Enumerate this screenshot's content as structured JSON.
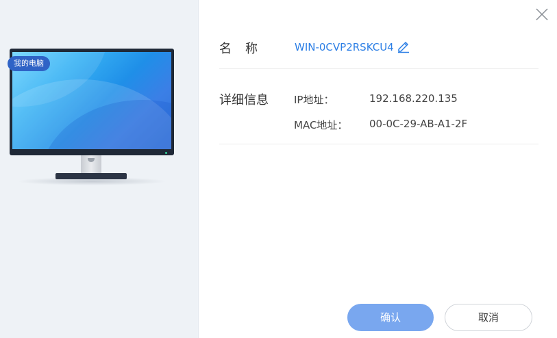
{
  "device": {
    "badge_label": "我的电脑"
  },
  "name_row": {
    "label": "名称",
    "value": "WIN-0CVP2RSKCU4",
    "edit_icon": "pencil-icon"
  },
  "details": {
    "label": "详细信息",
    "ip_label": "IP地址：",
    "ip_value": "192.168.220.135",
    "mac_label": "MAC地址：",
    "mac_value": "00-0C-29-AB-A1-2F"
  },
  "actions": {
    "confirm_label": "确认",
    "cancel_label": "取消",
    "close_icon": "close-icon"
  },
  "colors": {
    "accent": "#2b7ee5",
    "primary_button": "#79a7ef",
    "badge": "#2f63c6",
    "left_panel": "#eef2f6"
  }
}
